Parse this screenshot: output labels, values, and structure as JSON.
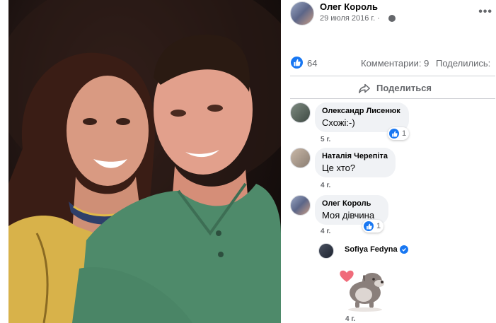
{
  "post": {
    "author": "Олег Король",
    "date": "29 июля 2016 г. ·",
    "more": "•••"
  },
  "stats": {
    "likes": "64",
    "comments": "Комментарии: 9",
    "shares": "Поделились:"
  },
  "actions": {
    "share_label": "Поделиться"
  },
  "comments": [
    {
      "author": "Олександр Лисенюк",
      "text": "Схожі:-)",
      "time": "5 г.",
      "reactions": "1"
    },
    {
      "author": "Наталія Черепіта",
      "text": "Це хто?",
      "time": "4 г."
    },
    {
      "author": "Олег Король",
      "text": "Моя дівчина",
      "time": "4 г.",
      "reactions": "1"
    }
  ],
  "reply": {
    "author": "Sofiya Fedyna",
    "time": "4 г.",
    "sticker": "dog-love-sticker"
  },
  "colors": {
    "accent": "#1877f2",
    "muted_text": "#65676b",
    "bubble_bg": "#f0f2f5"
  }
}
